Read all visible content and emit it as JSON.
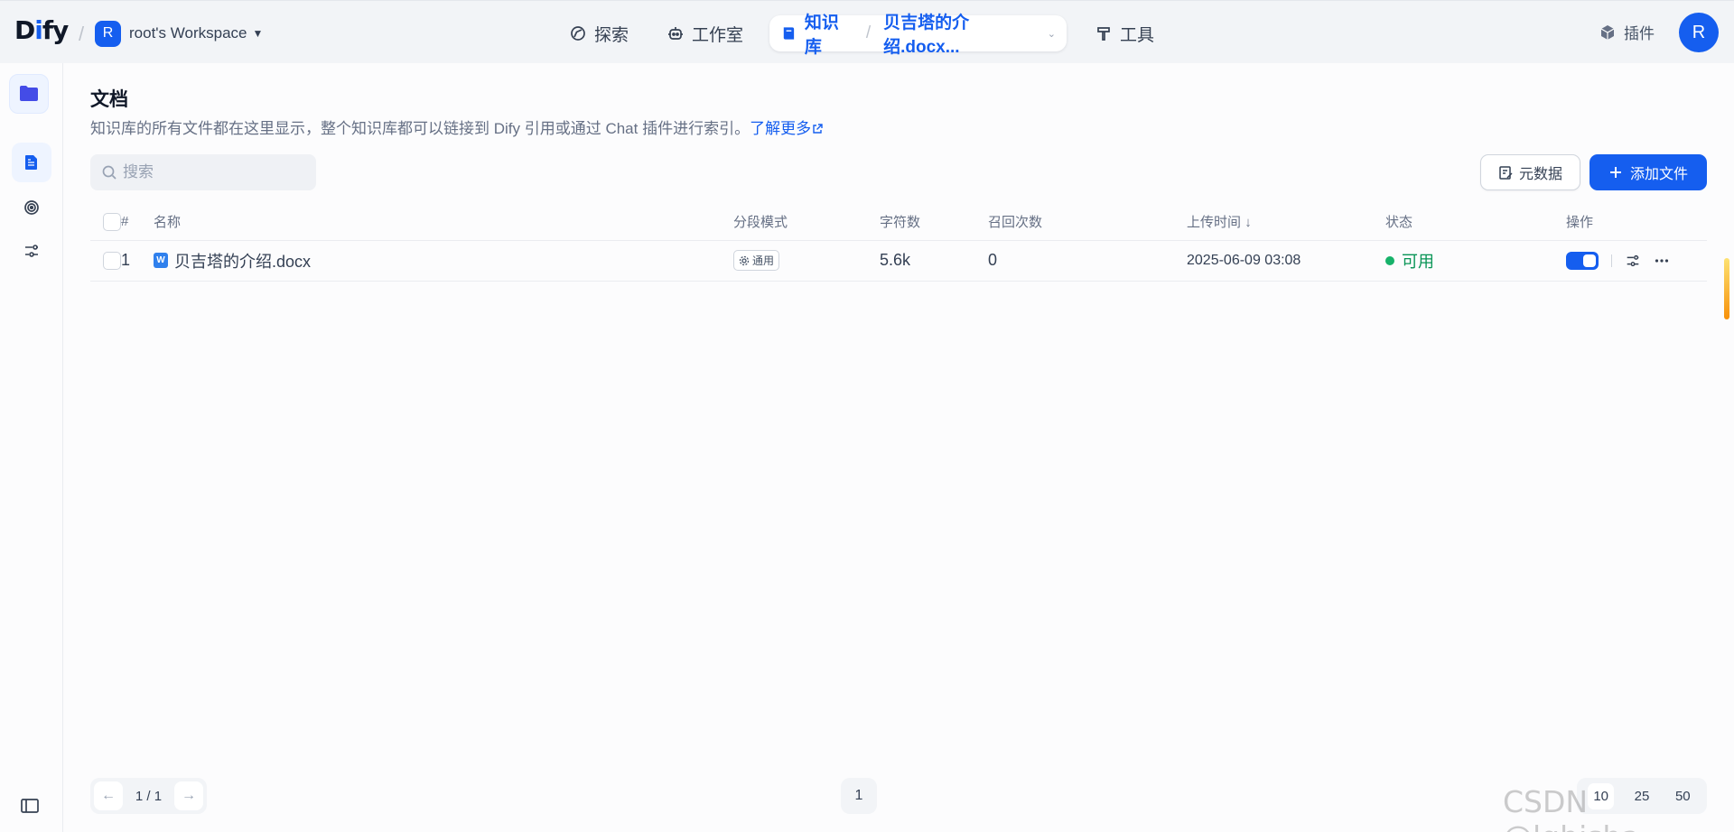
{
  "header": {
    "logo_text": "Dify",
    "workspace": {
      "initial": "R",
      "name": "root's Workspace"
    },
    "nav": {
      "explore": "探索",
      "studio": "工作室",
      "knowledge": "知识库",
      "current_doc": "贝吉塔的介绍.docx...",
      "tools": "工具"
    },
    "plugins_label": "插件",
    "avatar_initial": "R"
  },
  "colors": {
    "accent": "#155eef",
    "status_ok": "#17b26a"
  },
  "page": {
    "title": "文档",
    "description": "知识库的所有文件都在这里显示，整个知识库都可以链接到 Dify 引用或通过 Chat 插件进行索引。",
    "learn_more": "了解更多"
  },
  "toolbar": {
    "search_placeholder": "搜索",
    "metadata_button": "元数据",
    "add_file_button": "添加文件"
  },
  "table": {
    "headers": {
      "index": "#",
      "name": "名称",
      "mode": "分段模式",
      "chars": "字符数",
      "hits": "召回次数",
      "uploaded": "上传时间",
      "status": "状态",
      "actions": "操作"
    },
    "rows": [
      {
        "index": "1",
        "name": "贝吉塔的介绍.docx",
        "icon": "word-doc-icon",
        "mode": "通用",
        "chars": "5.6k",
        "hits": "0",
        "uploaded": "2025-06-09 03:08",
        "status": "可用",
        "enabled": true
      }
    ]
  },
  "pagination": {
    "page_count": "1 / 1",
    "current_page": "1",
    "page_sizes": [
      "10",
      "25",
      "50"
    ],
    "selected_size": "10"
  },
  "watermark": "CSDN @lgbisha"
}
